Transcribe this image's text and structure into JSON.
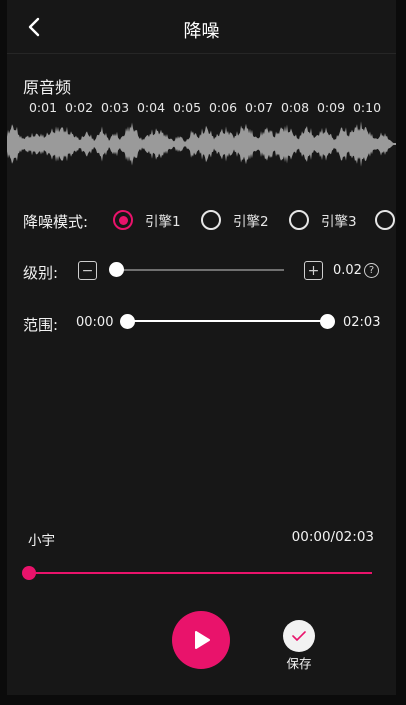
{
  "header": {
    "title": "降噪",
    "back_icon": "chevron-left-icon"
  },
  "original": {
    "label": "原音频",
    "timeline_ticks": [
      "0:01",
      "0:02",
      "0:03",
      "0:04",
      "0:05",
      "0:06",
      "0:07",
      "0:08",
      "0:09",
      "0:10"
    ]
  },
  "mode": {
    "label": "降噪模式:",
    "options": [
      {
        "label": "引擎1",
        "checked": true
      },
      {
        "label": "引擎2",
        "checked": false
      },
      {
        "label": "引擎3",
        "checked": false
      },
      {
        "label": "",
        "checked": false
      }
    ]
  },
  "level": {
    "label": "级别:",
    "value_text": "0.02",
    "fraction": 0.0
  },
  "range": {
    "label": "范围:",
    "start": "00:00",
    "end": "02:03"
  },
  "player": {
    "track_name": "小宇",
    "time": "00:00/02:03",
    "progress": 0.0
  },
  "actions": {
    "save_label": "保存"
  },
  "colors": {
    "accent": "#e9136b",
    "background": "#171717",
    "waveform": "#9a9a9a"
  }
}
